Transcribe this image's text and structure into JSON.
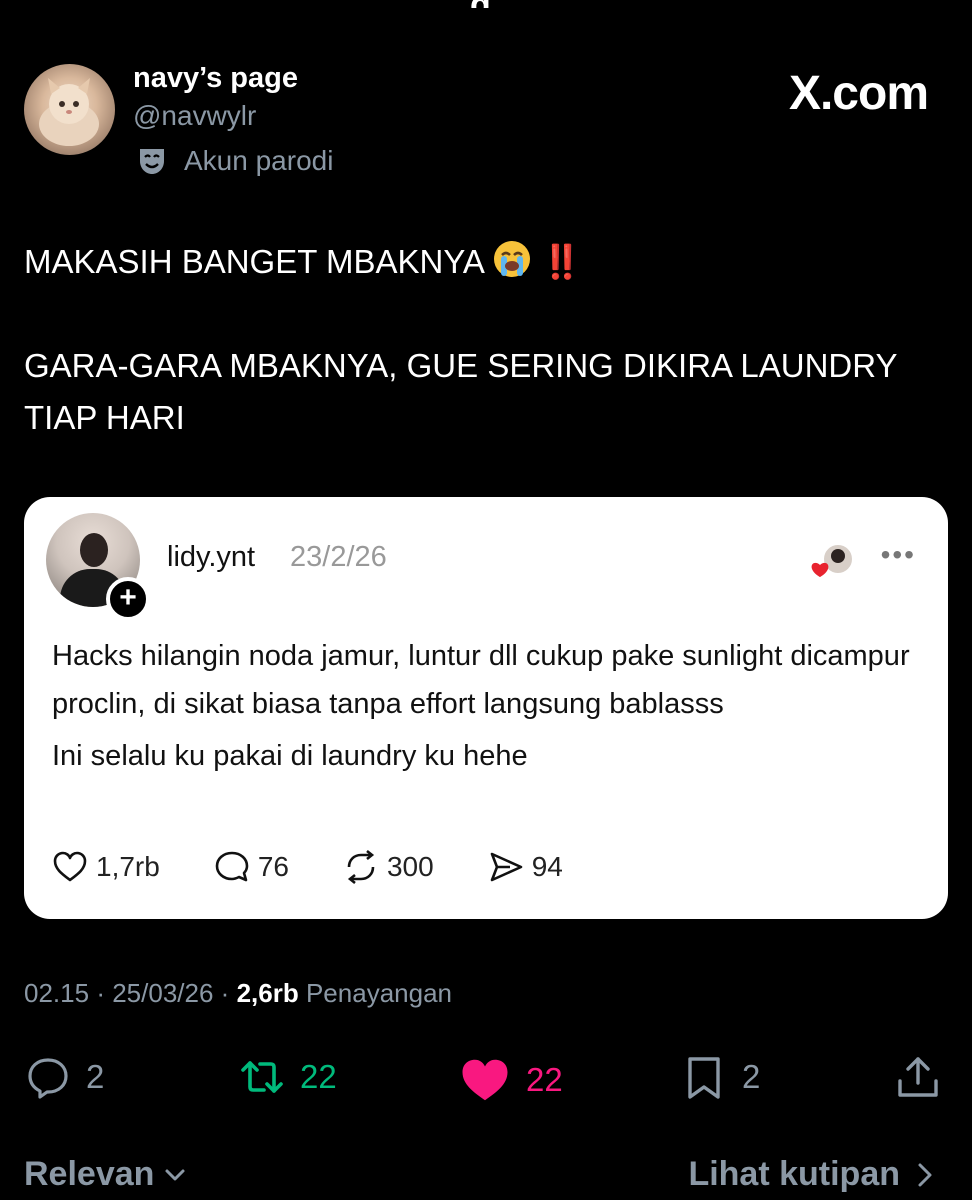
{
  "header": {
    "partial_top_text": "g",
    "display_name": "navy’s page",
    "handle": "@navwylr",
    "parody_label": "Akun parodi",
    "brand": "X.com"
  },
  "tweet": {
    "line1": "MAKASIH BANGET MBAKNYA",
    "line1_emoji": "loudly-crying-face",
    "line1_bangs": "‼️",
    "line2": "GARA-GARA MBAKNYA, GUE SERING DIKIRA LAUNDRY TIAP HARI"
  },
  "quoted_post": {
    "username": "lidy.ynt",
    "date": "23/2/26",
    "more_label": "•••",
    "body_line1": "Hacks hilangin noda jamur, luntur dll cukup pake sunlight dicampur proclin, di sikat biasa tanpa effort langsung bablasss",
    "body_line2": "Ini selalu ku pakai di laundry ku hehe",
    "stats": {
      "likes": "1,7rb",
      "comments": "76",
      "reposts": "300",
      "shares": "94"
    }
  },
  "meta": {
    "time": "02.15",
    "date": "25/03/26",
    "views_count": "2,6rb",
    "views_label": "Penayangan",
    "separator": "·"
  },
  "actions": {
    "replies": "2",
    "reposts": "22",
    "likes": "22",
    "bookmarks": "2"
  },
  "footer": {
    "sort_label": "Relevan",
    "quotes_link": "Lihat kutipan"
  },
  "colors": {
    "background": "#000000",
    "repost_green": "#00ba7c",
    "like_pink": "#f91880",
    "muted_gray": "#8b98a5"
  }
}
